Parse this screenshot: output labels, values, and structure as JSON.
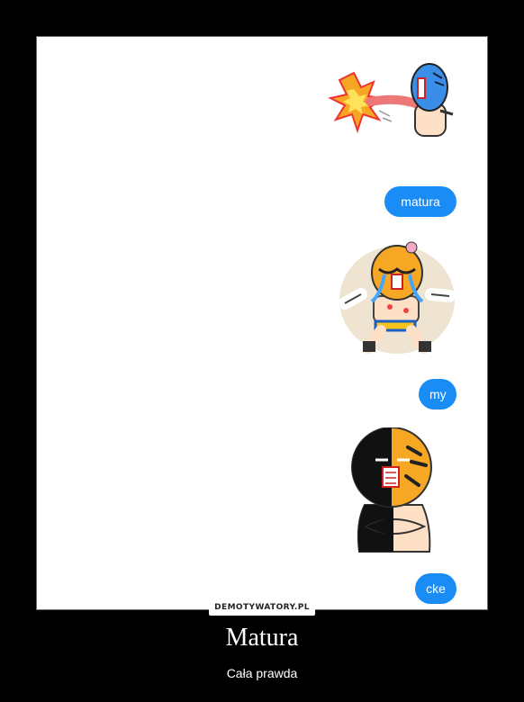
{
  "messages": [
    {
      "type": "sticker",
      "icon": "luchador-punch-sticker-icon"
    },
    {
      "type": "text",
      "text": "matura"
    },
    {
      "type": "sticker",
      "icon": "luchador-crying-sticker-icon"
    },
    {
      "type": "text",
      "text": "my"
    },
    {
      "type": "sticker",
      "icon": "luchador-arms-crossed-sticker-icon"
    },
    {
      "type": "text",
      "text": "cke"
    }
  ],
  "watermark": "DEMOTYWATORY.PL",
  "caption": {
    "title": "Matura",
    "subtitle": "Cała prawda"
  },
  "colors": {
    "bubble": "#1a8cf5",
    "background": "#000000",
    "frame": "#ffffff"
  }
}
